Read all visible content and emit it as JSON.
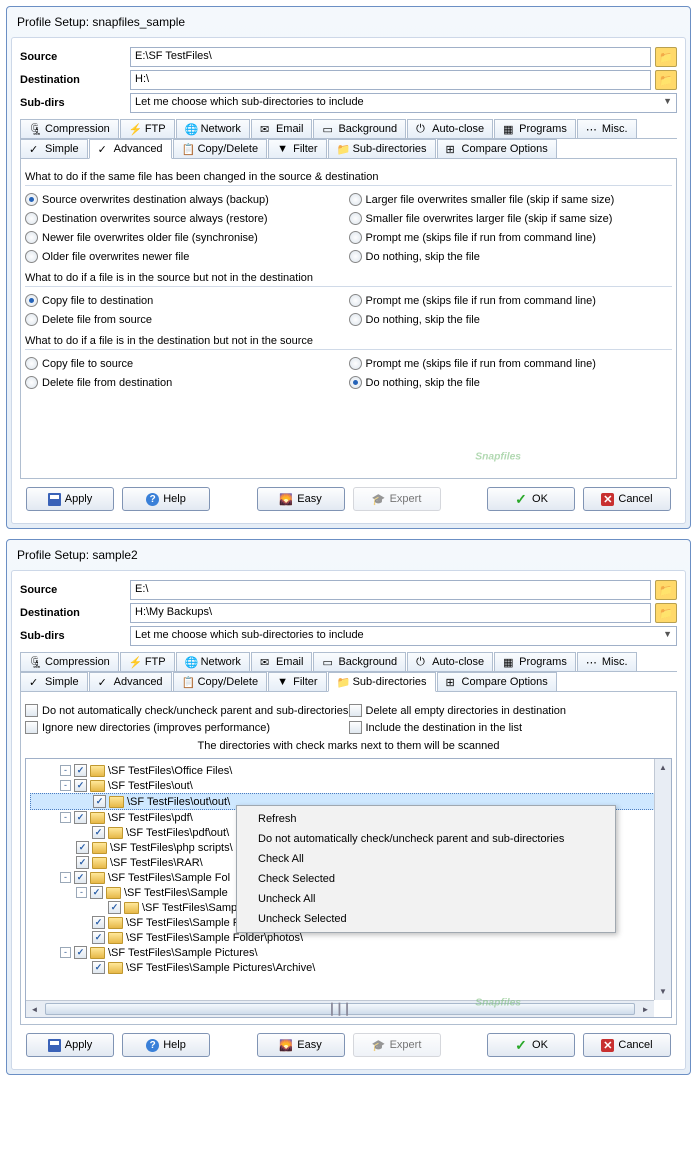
{
  "win1": {
    "title": "Profile Setup: snapfiles_sample",
    "labels": {
      "source": "Source",
      "destination": "Destination",
      "subdirs": "Sub-dirs"
    },
    "source": "E:\\SF TestFiles\\",
    "destination": "H:\\",
    "subdirs": "Let me choose which sub-directories to include",
    "tabs_top": [
      "Compression",
      "FTP",
      "Network",
      "Email",
      "Background",
      "Auto-close",
      "Programs",
      "Misc."
    ],
    "tabs_bot": [
      "Simple",
      "Advanced",
      "Copy/Delete",
      "Filter",
      "Sub-directories",
      "Compare Options"
    ],
    "secA": "What to do if the same file has been changed in the source & destination",
    "secA_left": [
      "Source overwrites destination always (backup)",
      "Destination overwrites source always (restore)",
      "Newer file overwrites older file (synchronise)",
      "Older file overwrites newer file"
    ],
    "secA_right": [
      "Larger file overwrites smaller file (skip if same size)",
      "Smaller file overwrites larger file (skip if same size)",
      "Prompt me (skips file if run from command line)",
      "Do nothing, skip the file"
    ],
    "secB": "What to do if a file is in the source but not in the destination",
    "secB_left": [
      "Copy file to destination",
      "Delete file from source"
    ],
    "secB_right": [
      "Prompt me  (skips file if run from command line)",
      "Do nothing, skip the file"
    ],
    "secC": "What to do if a file is in the destination but not in the source",
    "secC_left": [
      "Copy file to source",
      "Delete file from destination"
    ],
    "secC_right": [
      "Prompt me  (skips file if run from command line)",
      "Do nothing, skip the file"
    ]
  },
  "win2": {
    "title": "Profile Setup: sample2",
    "labels": {
      "source": "Source",
      "destination": "Destination",
      "subdirs": "Sub-dirs"
    },
    "source": "E:\\",
    "destination": "H:\\My Backups\\",
    "subdirs": "Let me choose which sub-directories to include",
    "tabs_top": [
      "Compression",
      "FTP",
      "Network",
      "Email",
      "Background",
      "Auto-close",
      "Programs",
      "Misc."
    ],
    "tabs_bot": [
      "Simple",
      "Advanced",
      "Copy/Delete",
      "Filter",
      "Sub-directories",
      "Compare Options"
    ],
    "checks": {
      "noauto": "Do not automatically check/uncheck parent and sub-directories",
      "ignore": "Ignore new directories (improves performance)",
      "deleteempty": "Delete all empty directories in destination",
      "includedest": "Include the destination in the list"
    },
    "scantext": "The directories with check marks next to them will be scanned",
    "tree": [
      {
        "d": 1,
        "e": "-",
        "t": "\\SF TestFiles\\Office Files\\"
      },
      {
        "d": 1,
        "e": "-",
        "t": "\\SF TestFiles\\out\\"
      },
      {
        "d": 2,
        "e": "",
        "t": "\\SF TestFiles\\out\\out\\",
        "sel": true
      },
      {
        "d": 1,
        "e": "-",
        "t": "\\SF TestFiles\\pdf\\"
      },
      {
        "d": 2,
        "e": "",
        "t": "\\SF TestFiles\\pdf\\out\\"
      },
      {
        "d": 1,
        "e": "",
        "t": "\\SF TestFiles\\php scripts\\"
      },
      {
        "d": 1,
        "e": "",
        "t": "\\SF TestFiles\\RAR\\"
      },
      {
        "d": 1,
        "e": "-",
        "t": "\\SF TestFiles\\Sample Fol"
      },
      {
        "d": 2,
        "e": "-",
        "t": "\\SF TestFiles\\Sample"
      },
      {
        "d": 3,
        "e": "",
        "t": "\\SF TestFiles\\Samp"
      },
      {
        "d": 2,
        "e": "",
        "t": "\\SF TestFiles\\Sample Folder\\"
      },
      {
        "d": 2,
        "e": "",
        "t": "\\SF TestFiles\\Sample Folder\\photos\\"
      },
      {
        "d": 1,
        "e": "-",
        "t": "\\SF TestFiles\\Sample Pictures\\"
      },
      {
        "d": 2,
        "e": "",
        "t": "\\SF TestFiles\\Sample Pictures\\Archive\\"
      }
    ],
    "contextmenu": [
      "Refresh",
      "Do not automatically check/uncheck parent and sub-directories",
      "Check All",
      "Check Selected",
      "Uncheck All",
      "Uncheck Selected"
    ]
  },
  "buttons": {
    "apply": "Apply",
    "help": "Help",
    "easy": "Easy",
    "expert": "Expert",
    "ok": "OK",
    "cancel": "Cancel"
  },
  "watermark": "Snapfiles"
}
